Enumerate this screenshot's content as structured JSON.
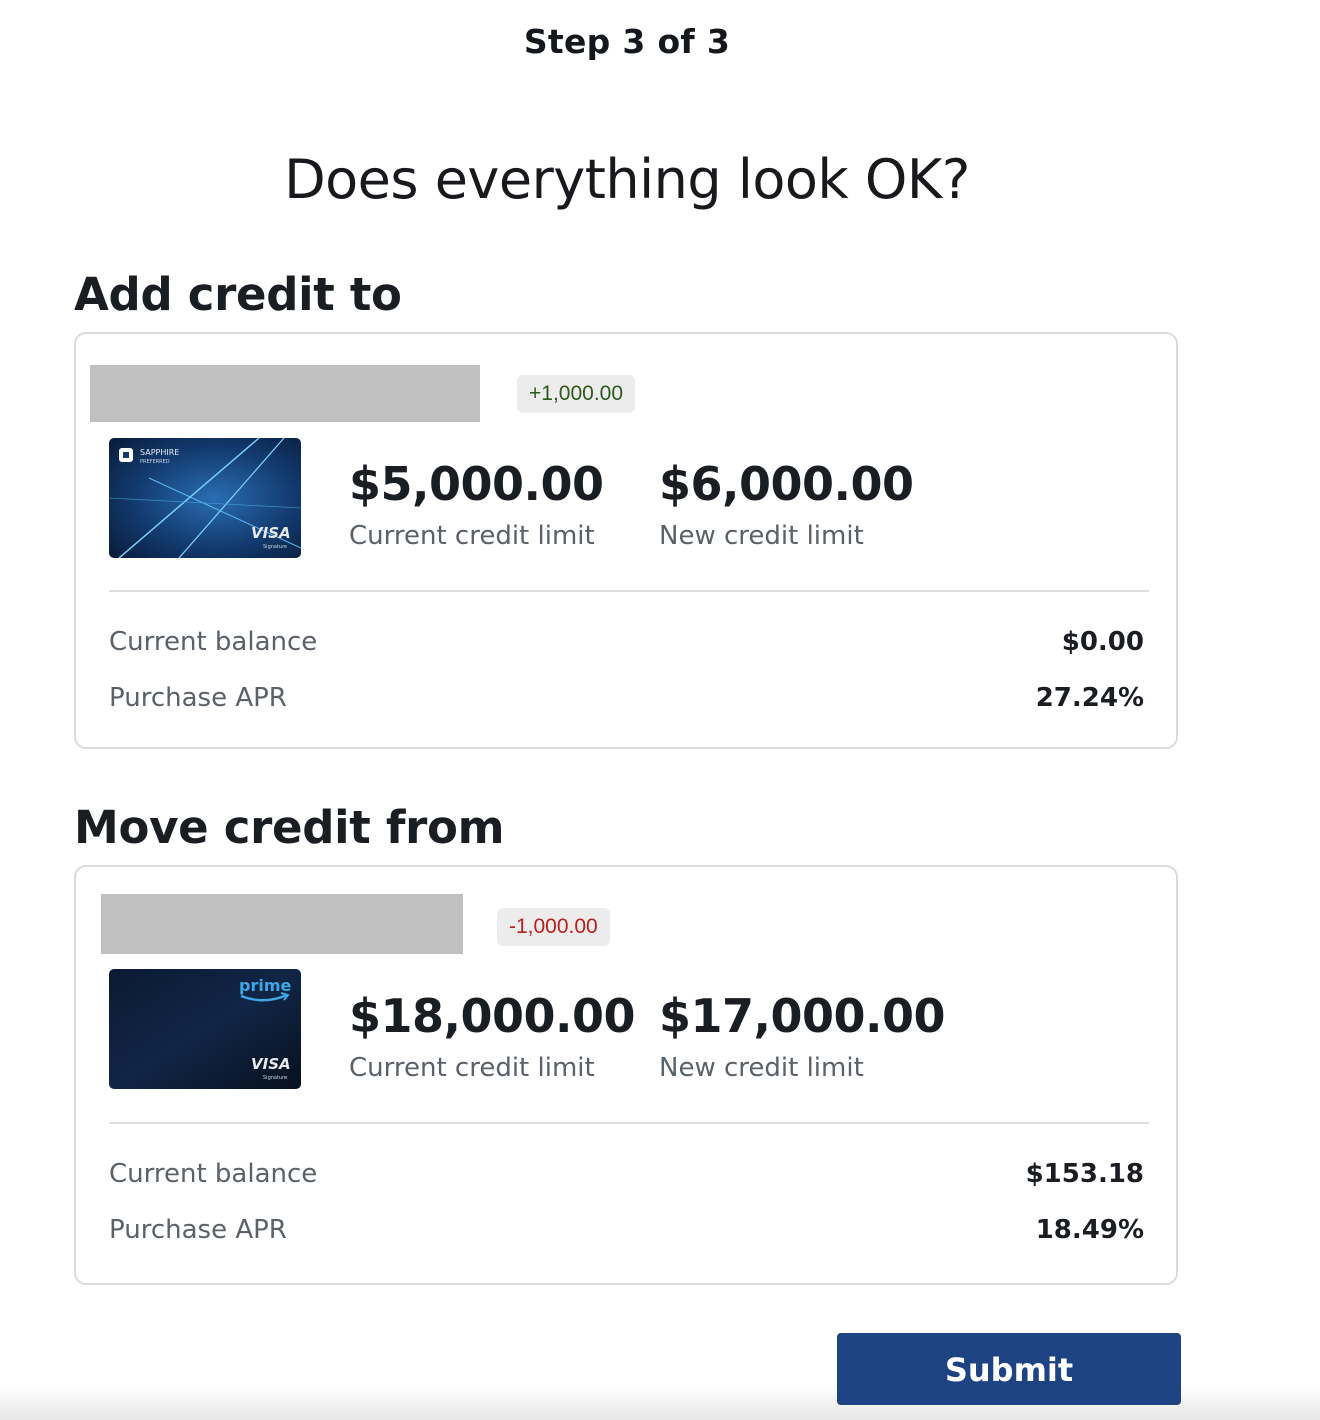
{
  "step": {
    "label": "Step 3 of 3"
  },
  "title": "Does everything look OK?",
  "add_section": {
    "heading": "Add credit to",
    "change_badge": "+1,000.00",
    "card": {
      "brand_line1": "SAPPHIRE",
      "brand_line2": "PREFERRED",
      "network": "VISA",
      "network_sub": "Signature"
    },
    "current_limit": {
      "value": "$5,000.00",
      "label": "Current credit limit"
    },
    "new_limit": {
      "value": "$6,000.00",
      "label": "New credit limit"
    },
    "rows": [
      {
        "label": "Current balance",
        "value": "$0.00"
      },
      {
        "label": "Purchase APR",
        "value": "27.24%"
      }
    ]
  },
  "move_section": {
    "heading": "Move credit from",
    "change_badge": "-1,000.00",
    "card": {
      "brand": "prime",
      "network": "VISA",
      "network_sub": "Signature"
    },
    "current_limit": {
      "value": "$18,000.00",
      "label": "Current credit limit"
    },
    "new_limit": {
      "value": "$17,000.00",
      "label": "New credit limit"
    },
    "rows": [
      {
        "label": "Current balance",
        "value": "$153.18"
      },
      {
        "label": "Purchase APR",
        "value": "18.49%"
      }
    ]
  },
  "submit": {
    "label": "Submit"
  },
  "colors": {
    "submit_bg": "#1d4383",
    "positive_badge_text": "#2b5a1a",
    "negative_badge_text": "#b8201c",
    "badge_bg": "#ececec",
    "redaction": "#c0c0c0"
  }
}
